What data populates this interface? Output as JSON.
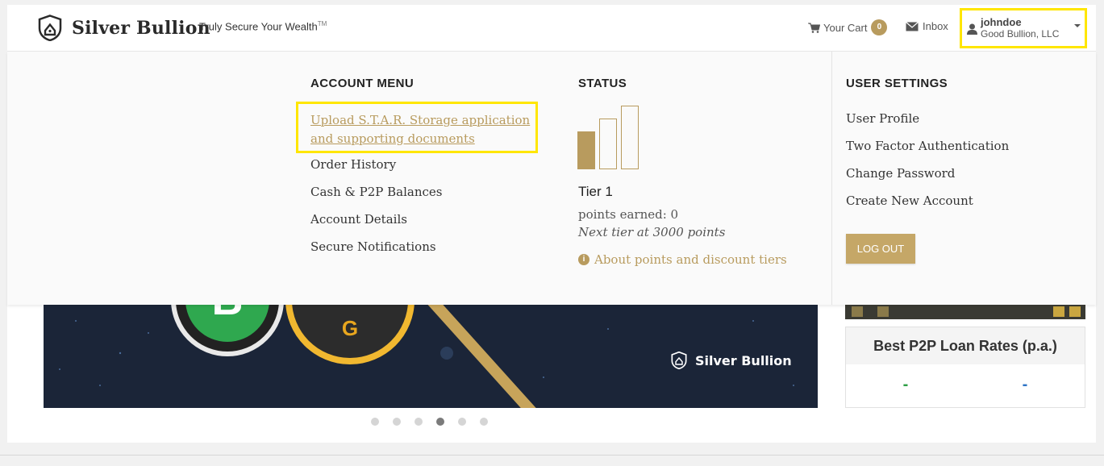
{
  "header": {
    "brand": "Silver Bullion",
    "tagline": "Truly Secure Your Wealth",
    "tagline_mark": "TM",
    "cart_label": "Your Cart",
    "cart_count": "0",
    "inbox_label": "Inbox",
    "user_name": "johndoe",
    "user_org": "Good Bullion, LLC"
  },
  "account_menu": {
    "heading": "ACCOUNT MENU",
    "upload_link": "Upload S.T.A.R. Storage application and supporting documents",
    "items": [
      "Order History",
      "Cash & P2P Balances",
      "Account Details",
      "Secure Notifications"
    ]
  },
  "status": {
    "heading": "STATUS",
    "tier": "Tier 1",
    "points": "points earned: 0",
    "next_tier": "Next tier at 3000 points",
    "about": "About points and discount tiers",
    "tier_level": 1,
    "tier_count": 3
  },
  "user_settings": {
    "heading": "USER SETTINGS",
    "items": [
      "User Profile",
      "Two Factor Authentication",
      "Change Password",
      "Create New Account"
    ],
    "logout": "LOG OUT"
  },
  "hero": {
    "coin1_letter": "B",
    "coin2_letter": "G",
    "brand": "Silver Bullion"
  },
  "carousel": {
    "count": 6,
    "active": 4
  },
  "loan_rates": {
    "title": "Best P2P Loan Rates (p.a.)",
    "value1": "-",
    "value2": "-"
  },
  "colors": {
    "accent": "#b89b5e",
    "highlight": "#ffe600",
    "hero_bg": "#1b2538"
  }
}
